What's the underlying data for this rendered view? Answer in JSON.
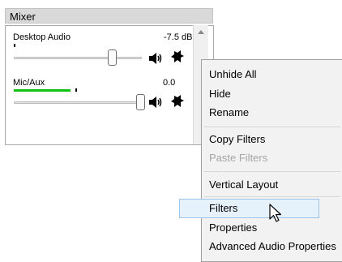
{
  "mixer": {
    "title": "Mixer",
    "channels": [
      {
        "name": "Desktop Audio",
        "level": "-7.5 dB",
        "fader_fraction": 0.74,
        "meter_fraction": 0.0
      },
      {
        "name": "Mic/Aux",
        "level": "0.0",
        "fader_fraction": 1.0,
        "meter_fraction": 0.4
      }
    ]
  },
  "context_menu": {
    "items": [
      {
        "label": "Unhide All",
        "enabled": true
      },
      {
        "label": "Hide",
        "enabled": true
      },
      {
        "label": "Rename",
        "enabled": true
      },
      {
        "label": "Copy Filters",
        "enabled": true
      },
      {
        "label": "Paste Filters",
        "enabled": false
      },
      {
        "label": "Vertical Layout",
        "enabled": true
      },
      {
        "label": "Filters",
        "enabled": true,
        "hovered": true
      },
      {
        "label": "Properties",
        "enabled": true
      },
      {
        "label": "Advanced Audio Properties",
        "enabled": true
      }
    ]
  },
  "colors": {
    "meter_green": "#12c212",
    "menu_bg": "#f2f2f2",
    "highlight_bg": "#e5f1fb",
    "highlight_border": "#9dc3e6"
  },
  "icons": [
    "speaker-icon",
    "gear-icon",
    "chevron-up-icon",
    "mouse-pointer-icon"
  ]
}
